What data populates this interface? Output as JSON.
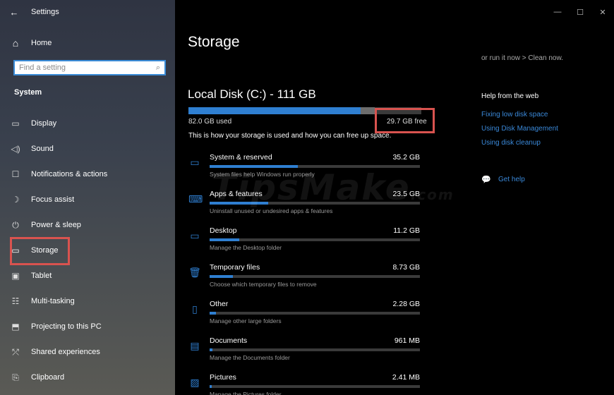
{
  "window": {
    "title": "Settings",
    "back": "←",
    "minimize": "—",
    "maximize": "☐",
    "close": "✕"
  },
  "sidebar": {
    "home_label": "Home",
    "search_placeholder": "Find a setting",
    "section_label": "System",
    "items": [
      {
        "label": "Display",
        "icon": "display-icon",
        "glyph": "▭"
      },
      {
        "label": "Sound",
        "icon": "sound-icon",
        "glyph": "◁)"
      },
      {
        "label": "Notifications & actions",
        "icon": "notifications-icon",
        "glyph": "☐"
      },
      {
        "label": "Focus assist",
        "icon": "moon-icon",
        "glyph": "☽"
      },
      {
        "label": "Power & sleep",
        "icon": "power-icon",
        "glyph": "⏻"
      },
      {
        "label": "Storage",
        "icon": "storage-icon",
        "glyph": "▭",
        "active": true
      },
      {
        "label": "Tablet",
        "icon": "tablet-icon",
        "glyph": "▣"
      },
      {
        "label": "Multi-tasking",
        "icon": "multitasking-icon",
        "glyph": "☷"
      },
      {
        "label": "Projecting to this PC",
        "icon": "projecting-icon",
        "glyph": "⬒"
      },
      {
        "label": "Shared experiences",
        "icon": "shared-icon",
        "glyph": "⤱"
      },
      {
        "label": "Clipboard",
        "icon": "clipboard-icon",
        "glyph": "⎘"
      }
    ]
  },
  "main": {
    "title": "Storage",
    "disk_title": "Local Disk (C:) - 111 GB",
    "used_fraction": 0.74,
    "used_text": "82.0 GB used",
    "free_text": "29.7 GB free",
    "info_text": "This is how your storage is used and how you can free up space.",
    "categories": [
      {
        "name": "System & reserved",
        "size": "35.2 GB",
        "desc": "System files help Windows run properly",
        "fill": 0.42,
        "icon": "laptop-icon",
        "glyph": "▭"
      },
      {
        "name": "Apps & features",
        "size": "23.5 GB",
        "desc": "Uninstall unused or undesired apps & features",
        "fill": 0.28,
        "icon": "apps-icon",
        "glyph": "⌨"
      },
      {
        "name": "Desktop",
        "size": "11.2 GB",
        "desc": "Manage the Desktop folder",
        "fill": 0.14,
        "icon": "desktop-icon",
        "glyph": "▭"
      },
      {
        "name": "Temporary files",
        "size": "8.73 GB",
        "desc": "Choose which temporary files to remove",
        "fill": 0.11,
        "icon": "trash-icon",
        "glyph": "🗑"
      },
      {
        "name": "Other",
        "size": "2.28 GB",
        "desc": "Manage other large folders",
        "fill": 0.03,
        "icon": "other-icon",
        "glyph": "▯"
      },
      {
        "name": "Documents",
        "size": "961 MB",
        "desc": "Manage the Documents folder",
        "fill": 0.012,
        "icon": "documents-icon",
        "glyph": "▤"
      },
      {
        "name": "Pictures",
        "size": "2.41 MB",
        "desc": "Manage the Pictures folder",
        "fill": 0.003,
        "icon": "pictures-icon",
        "glyph": "▨"
      }
    ]
  },
  "right": {
    "top_text": "or run it now > Clean now.",
    "help_heading": "Help from the web",
    "links": [
      "Fixing low disk space",
      "Using Disk Management",
      "Using disk cleanup"
    ],
    "get_help": "Get help"
  },
  "watermark": {
    "text": "TipsMake",
    "suffix": ".com"
  },
  "colors": {
    "accent": "#2f7fd1",
    "highlight_box": "#d9534f"
  }
}
